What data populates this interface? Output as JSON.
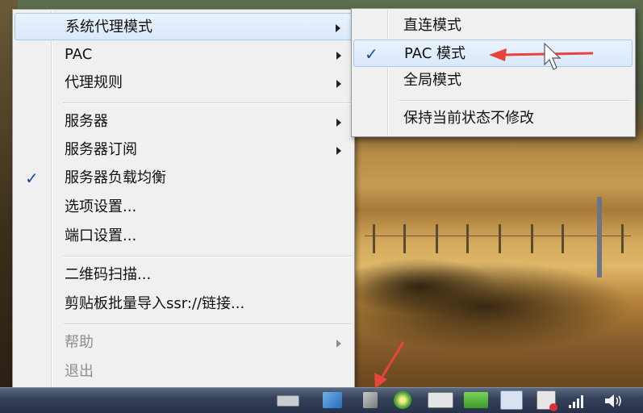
{
  "menu": {
    "items": [
      {
        "label": "系统代理模式",
        "has_submenu": true
      },
      {
        "label": "PAC",
        "has_submenu": true
      },
      {
        "label": "代理规则",
        "has_submenu": true
      },
      {
        "label": "服务器",
        "has_submenu": true
      },
      {
        "label": "服务器订阅",
        "has_submenu": true
      },
      {
        "label": "服务器负载均衡",
        "checked": true
      },
      {
        "label": "选项设置..."
      },
      {
        "label": "端口设置..."
      },
      {
        "label": "二维码扫描..."
      },
      {
        "label": "剪贴板批量导入ssr://链接..."
      },
      {
        "label": "帮助",
        "has_submenu": true,
        "disabled": true
      },
      {
        "label": "退出",
        "disabled": true
      }
    ],
    "highlighted_item": "系统代理模式"
  },
  "submenu": {
    "items": [
      {
        "label": "直连模式"
      },
      {
        "label": "PAC 模式",
        "checked": true
      },
      {
        "label": "全局模式"
      },
      {
        "label": "保持当前状态不修改"
      }
    ],
    "highlighted_item": "PAC 模式"
  },
  "check_mark": "✓",
  "annotation_color": "#e8443a",
  "highlight_color": "#d9e8fb",
  "taskbar": {
    "tray_icons": [
      "keyboard-icon",
      "app-icon",
      "shadowsocks-icon",
      "green-app-icon",
      "display-icon",
      "nvidia-icon",
      "document-icon",
      "action-center-icon",
      "network-icon",
      "volume-icon"
    ]
  }
}
